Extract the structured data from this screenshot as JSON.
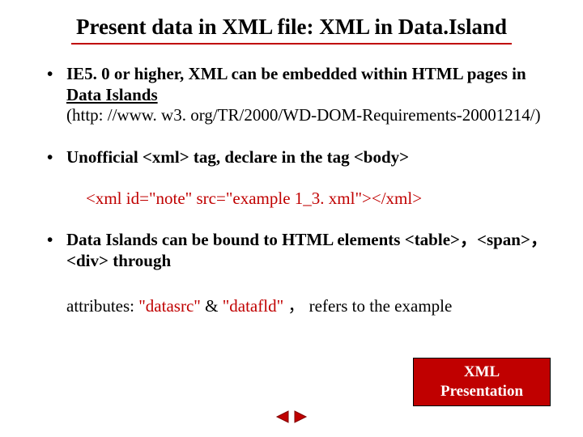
{
  "title": "Present data in XML file: XML in Data.Island",
  "bullets": {
    "b1_lead": "IE5. 0 or higher, XML can be embedded within HTML pages in ",
    "b1_underlined": "Data Islands",
    "b1_url": "(http: //www. w3. org/TR/2000/WD-DOM-Requirements-20001214/)",
    "b2": "Unofficial <xml> tag, declare in the tag <body>",
    "code": "<xml id=\"note\" src=\"example 1_3. xml\"></xml>",
    "b3": "Data Islands can be bound to HTML elements <table>，<span>，<div> through",
    "attr_prefix": "attributes:  ",
    "attr_a": "\"datasrc\"",
    "attr_amp": " & ",
    "attr_b": "\"datafld\"",
    "attr_suffix": " ， refers to the example"
  },
  "box": {
    "line1": "XML",
    "line2": "Presentation"
  }
}
